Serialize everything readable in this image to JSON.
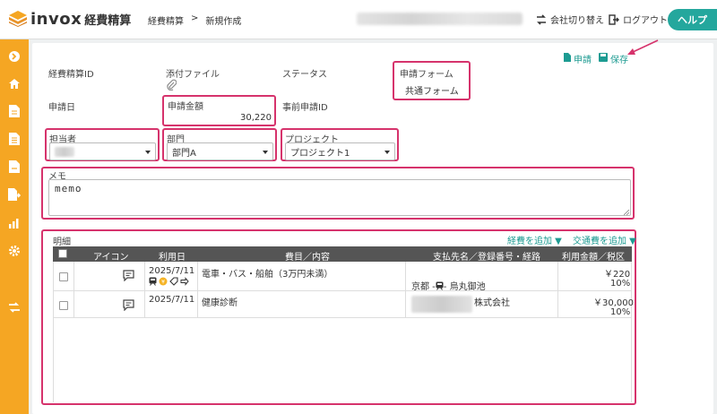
{
  "header": {
    "logo_text": "invox",
    "logo_sub": "経費精算",
    "breadcrumb": [
      "経費精算",
      ">",
      "新規作成"
    ],
    "switch_company": "会社切り替え",
    "logout": "ログアウト",
    "help": "ヘルプ"
  },
  "colors": {
    "accent": "#24a79d",
    "sidebar": "#f5a623",
    "highlight": "#d6336c",
    "link": "#1d9b92"
  },
  "actions": {
    "apply": "申請",
    "save": "保存"
  },
  "form": {
    "expense_id_label": "経費精算ID",
    "attachment_label": "添付ファイル",
    "status_label": "ステータス",
    "form_label": "申請フォーム",
    "form_value": "共通フォーム",
    "apply_date_label": "申請日",
    "amount_label": "申請金額",
    "amount_value": "30,220",
    "prior_id_label": "事前申請ID",
    "person_label": "担当者",
    "dept_label": "部門",
    "dept_value": "部門A",
    "project_label": "プロジェクト",
    "project_value": "プロジェクト1",
    "memo_label": "メモ",
    "memo_value": "memo"
  },
  "details": {
    "title": "明細",
    "add_expense": "経費を追加 ▼",
    "add_transport": "交通費を追加 ▼",
    "columns": [
      "アイコン",
      "利用日",
      "費目／内容",
      "支払先名／登録番号・経路",
      "利用金額／税区分"
    ],
    "rows": [
      {
        "date": "2025/7/11",
        "item": "電車・バス・船舶（3万円未満）",
        "route": "京都 - ",
        "route_to": " - 烏丸御池",
        "amount": "￥220",
        "tax": "10%"
      },
      {
        "date": "2025/7/11",
        "item": "健康診断",
        "payee": "株式会社",
        "amount": "￥30,000",
        "tax": "10%"
      }
    ]
  }
}
